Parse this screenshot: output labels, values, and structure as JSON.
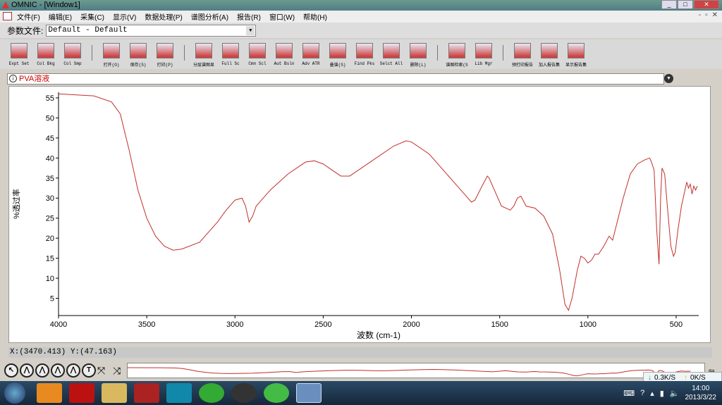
{
  "window": {
    "title": "OMNIC - [Window1]"
  },
  "menu": [
    "文件(F)",
    "编辑(E)",
    "采集(C)",
    "显示(V)",
    "数据处理(P)",
    "谱图分析(A)",
    "报告(R)",
    "窗口(W)",
    "帮助(H)"
  ],
  "profile": {
    "label": "参数文件:",
    "value": "Default - Default"
  },
  "toolbar": [
    {
      "label": "Expt Set",
      "group": 0
    },
    {
      "label": "Col Bkg",
      "group": 0
    },
    {
      "label": "Col Smp",
      "group": 0
    },
    {
      "label": "打开(O)",
      "group": 1
    },
    {
      "label": "保存(S)",
      "group": 1
    },
    {
      "label": "打印(P)",
      "group": 1
    },
    {
      "label": "分层谱图显",
      "group": 2
    },
    {
      "label": "Full Sc",
      "group": 2
    },
    {
      "label": "Cmn Scl",
      "group": 2
    },
    {
      "label": "Aut Bsln",
      "group": 2
    },
    {
      "label": "Adv ATR",
      "group": 2
    },
    {
      "label": "叠谱(S)",
      "group": 2
    },
    {
      "label": "Find Pks",
      "group": 2
    },
    {
      "label": "Selct All",
      "group": 2
    },
    {
      "label": "删除(L)",
      "group": 2
    },
    {
      "label": "谱图检索(S",
      "group": 3
    },
    {
      "label": "Lib Mgr",
      "group": 3
    },
    {
      "label": "预打印报告",
      "group": 4
    },
    {
      "label": "加入报告集",
      "group": 4
    },
    {
      "label": "显示报告集",
      "group": 4
    }
  ],
  "spectrum_title": "PVA溶液",
  "chart_data": {
    "type": "line",
    "xlabel": "波数 (cm-1)",
    "ylabel": "%透过率",
    "xlim": [
      4000,
      372
    ],
    "ylim": [
      0.7,
      56.4
    ],
    "xticks": [
      4000,
      3500,
      3000,
      2500,
      2000,
      1500,
      1000,
      500
    ],
    "yticks": [
      5,
      10,
      15,
      20,
      25,
      30,
      35,
      40,
      45,
      50,
      55
    ],
    "color": "#c0302a",
    "x": [
      4000,
      3800,
      3700,
      3650,
      3600,
      3550,
      3500,
      3450,
      3400,
      3350,
      3300,
      3200,
      3100,
      3050,
      3000,
      2960,
      2940,
      2920,
      2900,
      2880,
      2850,
      2800,
      2700,
      2600,
      2550,
      2500,
      2450,
      2400,
      2350,
      2300,
      2200,
      2100,
      2030,
      2000,
      1900,
      1800,
      1700,
      1660,
      1640,
      1600,
      1570,
      1560,
      1520,
      1490,
      1440,
      1420,
      1400,
      1380,
      1350,
      1300,
      1250,
      1200,
      1160,
      1130,
      1110,
      1090,
      1060,
      1040,
      1020,
      1000,
      980,
      960,
      940,
      910,
      880,
      860,
      840,
      800,
      760,
      720,
      680,
      650,
      640,
      625,
      610,
      597,
      588,
      580,
      565,
      550,
      530,
      515,
      505,
      490,
      470,
      450,
      440,
      430,
      420,
      410,
      400,
      390,
      380
    ],
    "y": [
      56,
      55.5,
      54,
      51,
      42,
      32,
      25,
      20.5,
      18,
      17,
      17.3,
      19,
      24,
      27,
      29.5,
      30,
      28,
      24,
      25.5,
      28,
      29.5,
      32,
      36,
      39,
      39.3,
      38.5,
      37,
      35.5,
      35.5,
      37,
      40,
      43,
      44.3,
      44,
      41,
      36,
      31,
      29,
      29.5,
      33,
      35.5,
      35,
      31,
      28,
      27,
      28,
      30,
      30.5,
      28,
      27.5,
      25.5,
      21,
      12,
      3.5,
      2,
      5,
      12,
      15.5,
      15,
      13.8,
      14.5,
      16,
      16,
      18,
      20.5,
      19.5,
      23,
      30,
      36,
      38.5,
      39.5,
      40,
      39,
      37,
      22,
      13.5,
      30,
      37.5,
      36,
      28,
      18,
      15.5,
      16.5,
      22,
      28,
      32,
      34,
      32.5,
      33.5,
      31,
      33,
      32,
      33
    ]
  },
  "coords": "X:(3470.413) Y:(47.163)",
  "tray": {
    "down": "0.3K/S",
    "up": "0K/S",
    "time": "14:00",
    "date": "2013/3/22"
  }
}
